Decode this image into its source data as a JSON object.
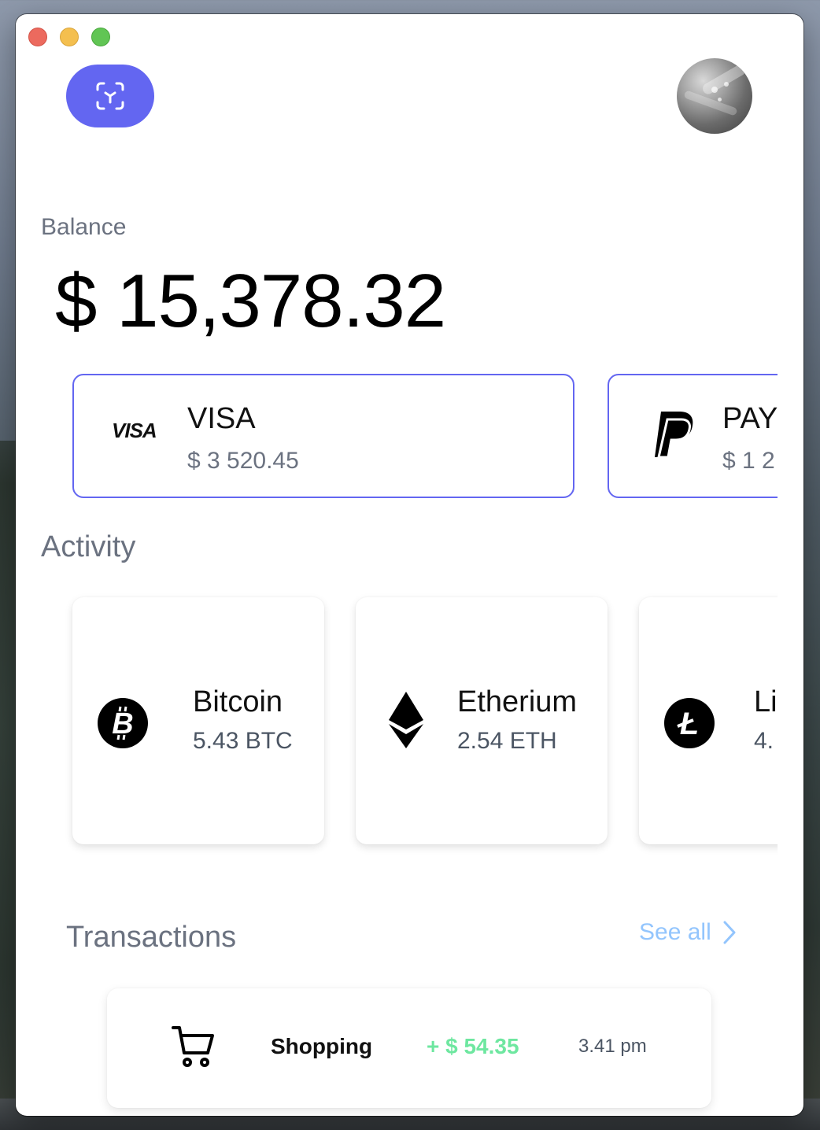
{
  "header": {
    "logo_icon": "scan-face-icon",
    "accent_color": "#6366f1"
  },
  "balance": {
    "label": "Balance",
    "value": "$ 15,378.32"
  },
  "payment_cards": [
    {
      "brand_icon": "visa-logo",
      "brand_text": "VISA",
      "name": "VISA",
      "amount": "$ 3 520.45"
    },
    {
      "brand_icon": "paypal-logo",
      "name": "PAY",
      "amount": "$ 1 2"
    }
  ],
  "activity": {
    "label": "Activity",
    "coins": [
      {
        "icon": "bitcoin-icon",
        "name": "Bitcoin",
        "amount": "5.43 BTC"
      },
      {
        "icon": "ethereum-icon",
        "name": "Etherium",
        "amount": "2.54 ETH"
      },
      {
        "icon": "litecoin-icon",
        "name": "Li",
        "amount": "4."
      }
    ]
  },
  "transactions": {
    "label": "Transactions",
    "see_all": "See all",
    "items": [
      {
        "icon": "cart-icon",
        "name": "Shopping",
        "amount": "+ $ 54.35",
        "time": "3.41 pm",
        "amount_color": "#6ee7a0"
      }
    ]
  }
}
